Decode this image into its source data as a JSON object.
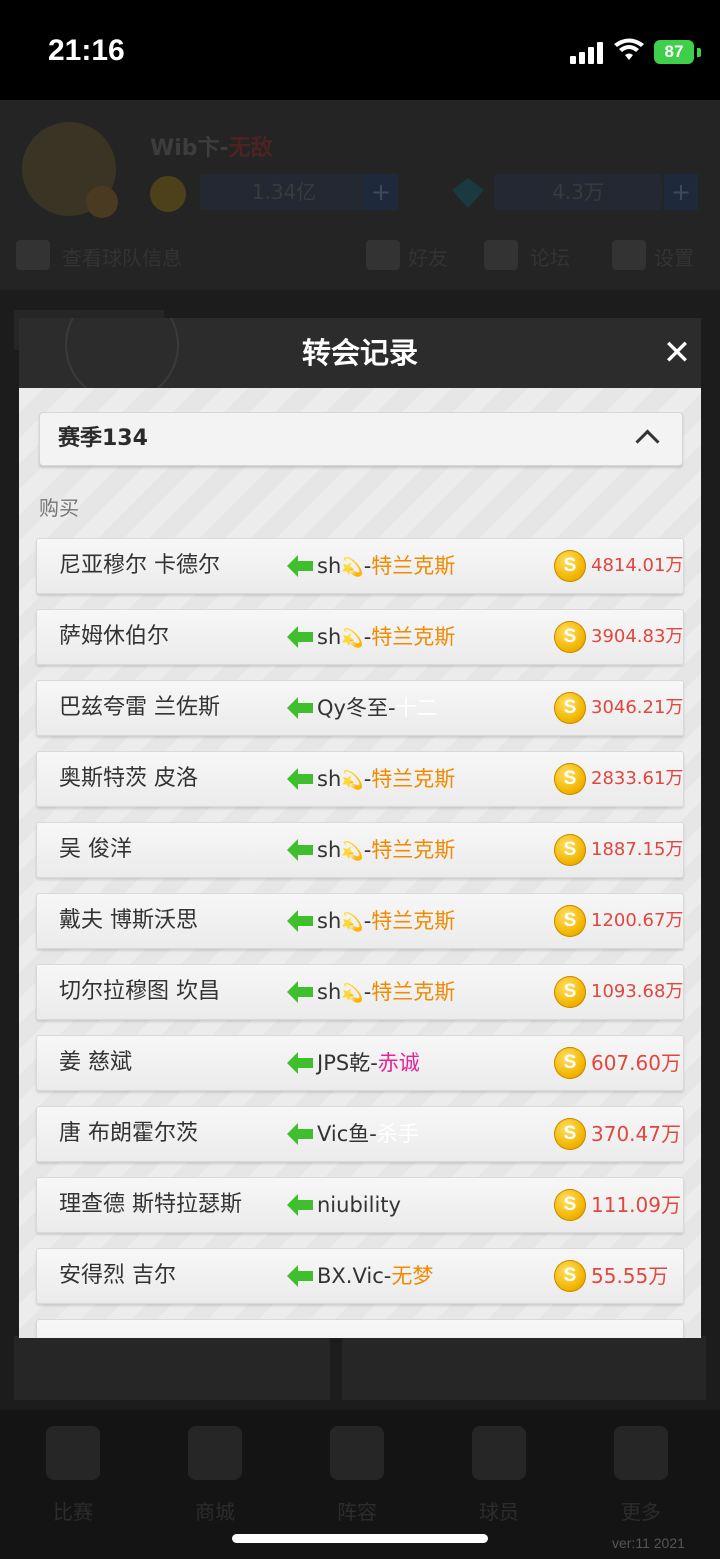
{
  "status_bar": {
    "time": "21:16",
    "battery": "87"
  },
  "background": {
    "player_name": "Wib卞-",
    "player_tag": "无敌",
    "coins": "1.34亿",
    "gems": "4.3万",
    "team_info": "查看球队信息",
    "nav": [
      "好友",
      "论坛",
      "设置"
    ],
    "footer_tabs": [
      "比赛",
      "商城",
      "阵容",
      "球员",
      "更多"
    ],
    "version": "ver:11   2021"
  },
  "modal": {
    "title": "转会记录",
    "close": "✕",
    "season": "赛季134",
    "section": "购买",
    "rows": [
      {
        "player": "尼亚穆尔 卡德尔",
        "seller": "sh",
        "emoji": "💫",
        "club": "特兰克斯",
        "club_color": "orange",
        "price": "4814.01万"
      },
      {
        "player": "萨姆休伯尔",
        "seller": "sh",
        "emoji": "💫",
        "club": "特兰克斯",
        "club_color": "orange",
        "price": "3904.83万"
      },
      {
        "player": "巴兹夸雷 兰佐斯",
        "seller": "Qy冬至",
        "emoji": "",
        "club": "十二",
        "club_color": "white",
        "price": "3046.21万"
      },
      {
        "player": "奥斯特茨 皮洛",
        "seller": "sh",
        "emoji": "💫",
        "club": "特兰克斯",
        "club_color": "orange",
        "price": "2833.61万"
      },
      {
        "player": "吴 俊洋",
        "seller": "sh",
        "emoji": "💫",
        "club": "特兰克斯",
        "club_color": "orange",
        "price": "1887.15万"
      },
      {
        "player": "戴夫 博斯沃思",
        "seller": "sh",
        "emoji": "💫",
        "club": "特兰克斯",
        "club_color": "orange",
        "price": "1200.67万"
      },
      {
        "player": "切尔拉穆图 坎昌",
        "seller": "sh",
        "emoji": "💫",
        "club": "特兰克斯",
        "club_color": "orange",
        "price": "1093.68万"
      },
      {
        "player": "姜 慈斌",
        "seller": "JPS乾",
        "emoji": "",
        "club": "赤诚",
        "club_color": "pink",
        "price": "607.60万"
      },
      {
        "player": "唐 布朗霍尔茨",
        "seller": "Vic鱼",
        "emoji": "",
        "club": "杀手",
        "club_color": "white",
        "price": "370.47万"
      },
      {
        "player": "理查德 斯特拉瑟斯",
        "seller": "niubility",
        "emoji": "",
        "club": "",
        "club_color": "none",
        "price": "111.09万"
      },
      {
        "player": "安得烈 吉尔",
        "seller": "BX.Vic",
        "emoji": "",
        "club": "无梦",
        "club_color": "orange",
        "price": "55.55万"
      }
    ]
  }
}
